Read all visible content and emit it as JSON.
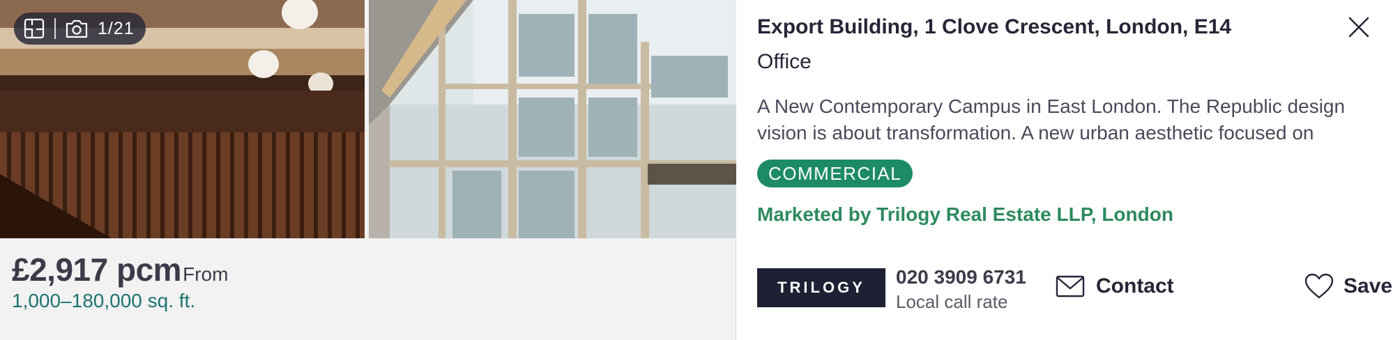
{
  "gallery": {
    "current_photo": "1/21",
    "photos": [
      "atrium-staircase-photo",
      "glass-atrium-photo"
    ]
  },
  "pricing": {
    "price": "£2,917 pcm",
    "price_qualifier": "From",
    "size_range": "1,000–180,000 sq. ft."
  },
  "listing": {
    "title": "Export Building, 1 Clove Crescent, London, E14",
    "property_type": "Office",
    "description": "A New Contemporary Campus in East London. The Republic design vision is about transformation. A new urban aesthetic focused on",
    "tag": "COMMERCIAL",
    "marketed_by": "Marketed by Trilogy Real Estate LLP, London"
  },
  "agent": {
    "logo_text": "TRILOGY",
    "phone": "020 3909 6731",
    "phone_note": "Local call rate",
    "contact_label": "Contact",
    "save_label": "Save"
  },
  "colors": {
    "accent_green": "#1d8a68",
    "marketed_green": "#2d8a5e",
    "size_teal": "#1d7371",
    "agent_navy": "#1e2133"
  },
  "icons": [
    "floorplan-icon",
    "camera-icon",
    "close-icon",
    "envelope-icon",
    "heart-icon"
  ]
}
